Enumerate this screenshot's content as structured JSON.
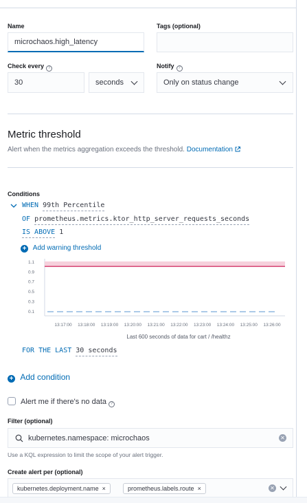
{
  "form": {
    "name_label": "Name",
    "name_value": "microchaos.high_latency",
    "tags_label": "Tags (optional)",
    "tags_value": "",
    "check_every_label": "Check every",
    "check_every_value": "30",
    "check_every_unit": "seconds",
    "notify_label": "Notify",
    "notify_value": "Only on status change"
  },
  "metric": {
    "title": "Metric threshold",
    "subtitle": "Alert when the metrics aggregation exceeds the threshold.",
    "doc_link": "Documentation"
  },
  "conditions": {
    "label": "Conditions",
    "when_kw": "WHEN",
    "when_value": "99th Percentile",
    "of_kw": "OF",
    "of_value": "prometheus.metrics.ktor_http_server_requests_seconds",
    "is_kw": "IS ABOVE",
    "is_value": "1",
    "add_warning": "Add warning threshold",
    "for_kw": "FOR THE LAST",
    "for_value": "30 seconds",
    "add_condition": "Add condition"
  },
  "chart_data": {
    "type": "line",
    "title": "",
    "x": [
      "13:17:00",
      "13:18:00",
      "13:19:00",
      "13:20:00",
      "13:21:00",
      "13:22:00",
      "13:23:00",
      "13:24:00",
      "13:25:00",
      "13:26:00"
    ],
    "y_ticks": [
      "1.1",
      "0.9",
      "0.7",
      "0.5",
      "0.3",
      "0.1"
    ],
    "ylim": [
      0,
      1.1
    ],
    "threshold": 1,
    "series": [
      {
        "values": [
          0,
          0,
          0,
          0,
          0,
          0,
          0,
          0,
          0,
          0
        ]
      }
    ],
    "caption": "Last 600 seconds of data for cart / /healthz",
    "colors": {
      "threshold": "#d23669",
      "threshold_fill": "#f6d0dc",
      "series": "#79aad9"
    }
  },
  "no_data": {
    "label": "Alert me if there's no data"
  },
  "filter": {
    "label": "Filter (optional)",
    "value": "kubernetes.namespace: microchaos",
    "help": "Use a KQL expression to limit the scope of your alert trigger."
  },
  "group_by": {
    "label": "Create alert per (optional)",
    "pills": [
      "kubernetes.deployment.name",
      "prometheus.labels.route"
    ]
  }
}
